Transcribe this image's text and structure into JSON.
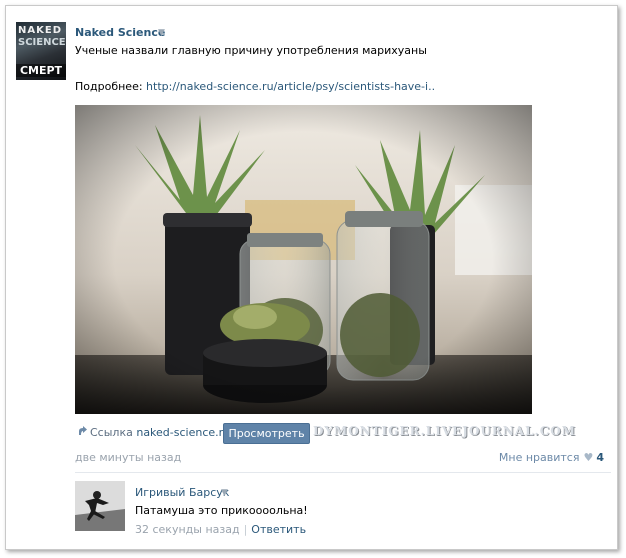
{
  "post": {
    "author": "Naked Science",
    "author_menu_icon": "triangle-down-icon",
    "avatar_text": [
      "NAKED",
      "SCIENCE",
      "СМЕРТ"
    ],
    "text": "Ученые назвали главную причину употребления марихуаны",
    "more_label": "Подробнее:",
    "more_url": "http://naked-science.ru/article/psy/scientists-have-i..",
    "link_prefix": "Ссылка",
    "link_site": "naked-science.ru",
    "view_button": "Просмотреть",
    "watermark": "DYMONTIGER.LIVEJOURNAL.COM",
    "time": "две минуты назад",
    "like_label": "Мне нравится",
    "like_count": "4",
    "like_icon": "heart-icon"
  },
  "comment": {
    "author": "Игривый Барсук",
    "text": "Патамуша это прикоооольна!",
    "time": "32 секунды назад",
    "separator": "|",
    "reply_label": "Ответить"
  },
  "colors": {
    "link": "#2b587a",
    "button": "#5f83a8",
    "muted": "#9aa3ad"
  }
}
